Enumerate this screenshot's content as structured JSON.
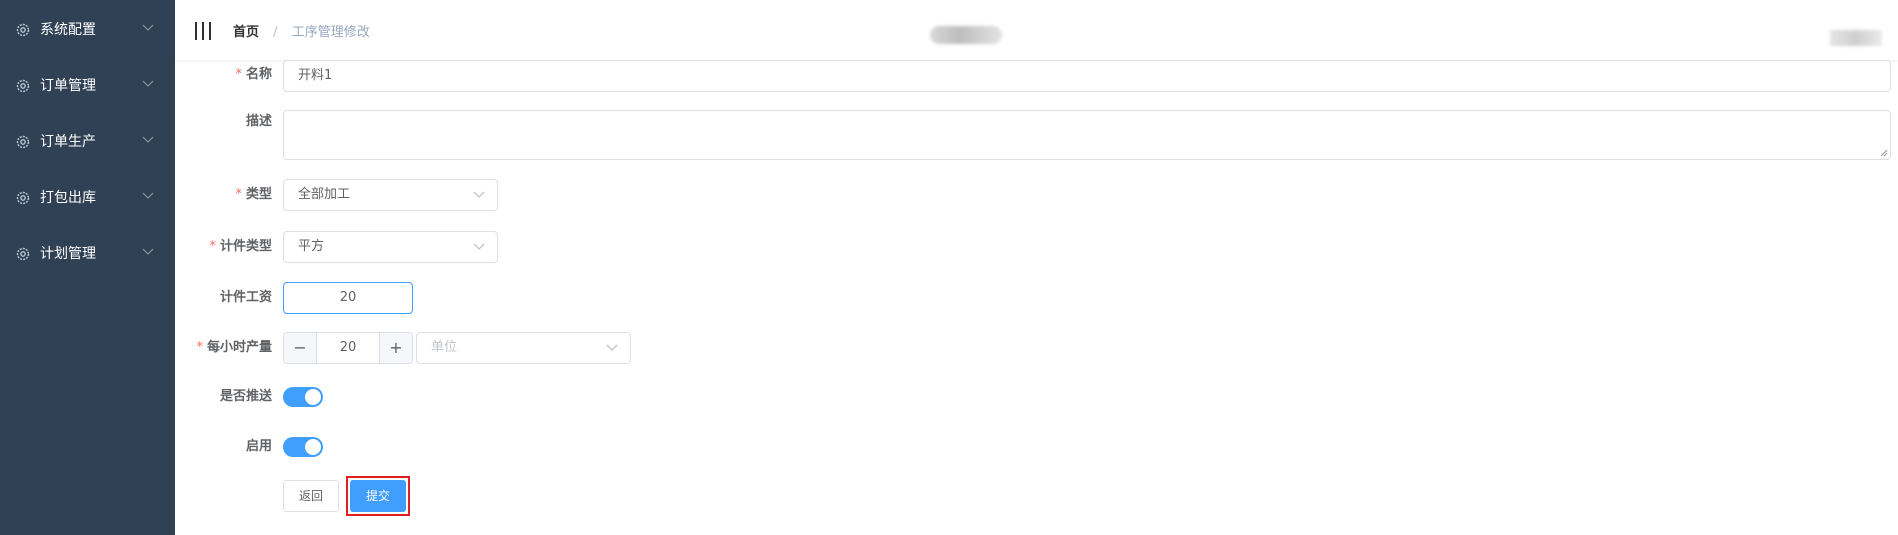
{
  "sidebar": {
    "items": [
      {
        "label": "系统配置",
        "icon": "gear-icon"
      },
      {
        "label": "订单管理",
        "icon": "gear-icon"
      },
      {
        "label": "订单生产",
        "icon": "gear-icon"
      },
      {
        "label": "打包出库",
        "icon": "gear-icon"
      },
      {
        "label": "计划管理",
        "icon": "gear-icon"
      }
    ]
  },
  "header": {
    "breadcrumb": {
      "home": "首页",
      "separator": "/",
      "current": "工序管理修改"
    }
  },
  "form": {
    "name": {
      "label": "名称",
      "required": "*",
      "value": "开料1"
    },
    "description": {
      "label": "描述",
      "value": ""
    },
    "type": {
      "label": "类型",
      "required": "*",
      "value": "全部加工"
    },
    "count_type": {
      "label": "计件类型",
      "required": "*",
      "value": "平方"
    },
    "piece_wage": {
      "label": "计件工资",
      "value": "20"
    },
    "hourly_output": {
      "label": "每小时产量",
      "required": "*",
      "value": "20",
      "minus": "−",
      "plus": "+",
      "unit_placeholder": "单位"
    },
    "push": {
      "label": "是否推送",
      "enabled": true
    },
    "enabled": {
      "label": "启用",
      "enabled": true
    },
    "buttons": {
      "back": "返回",
      "submit": "提交"
    }
  },
  "colors": {
    "sidebar_bg": "#304156",
    "primary": "#409eff",
    "required": "#f56c6c",
    "highlight": "#e02020"
  }
}
